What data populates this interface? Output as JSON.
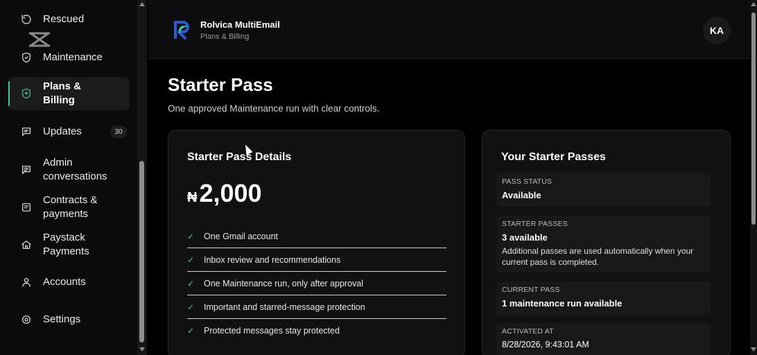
{
  "sidebar": {
    "items": [
      {
        "label": "Rescued",
        "icon": "refresh-icon"
      },
      {
        "label": "Maintenance",
        "icon": "shield-icon"
      },
      {
        "label": "Plans & Billing",
        "icon": "shield-icon"
      },
      {
        "label": "Updates",
        "icon": "chat-icon",
        "badge": "30"
      },
      {
        "label": "Admin conversations",
        "icon": "inbox-icon"
      },
      {
        "label": "Contracts & payments",
        "icon": "document-icon"
      },
      {
        "label": "Paystack Payments",
        "icon": "home-icon"
      },
      {
        "label": "Accounts",
        "icon": "user-icon"
      },
      {
        "label": "Settings",
        "icon": "gear-icon"
      }
    ],
    "active_index": 2,
    "accent": "#3fc7a2"
  },
  "header": {
    "title": "Rolvica MultiEmail",
    "subtitle": "Plans & Billing",
    "avatar": "KA"
  },
  "main": {
    "title": "Starter Pass",
    "subtitle": "One approved Maintenance run with clear controls."
  },
  "details_card": {
    "title": "Starter Pass Details",
    "currency": "₦",
    "price": "2,000",
    "features": [
      "One Gmail account",
      "Inbox review and recommendations",
      "One Maintenance run, only after approval",
      "Important and starred-message protection",
      "Protected messages stay protected"
    ]
  },
  "passes_card": {
    "title": "Your Starter Passes",
    "pass_status_label": "PASS STATUS",
    "pass_status_value": "Available",
    "starter_passes_label": "STARTER PASSES",
    "starter_passes_value": "3 available",
    "starter_passes_note": "Additional passes are used automatically when your current pass is completed.",
    "current_pass_label": "CURRENT PASS",
    "current_pass_value": "1 maintenance run available",
    "activated_label": "ACTIVATED AT",
    "activated_value": "8/28/2026, 9:43:01 AM"
  }
}
